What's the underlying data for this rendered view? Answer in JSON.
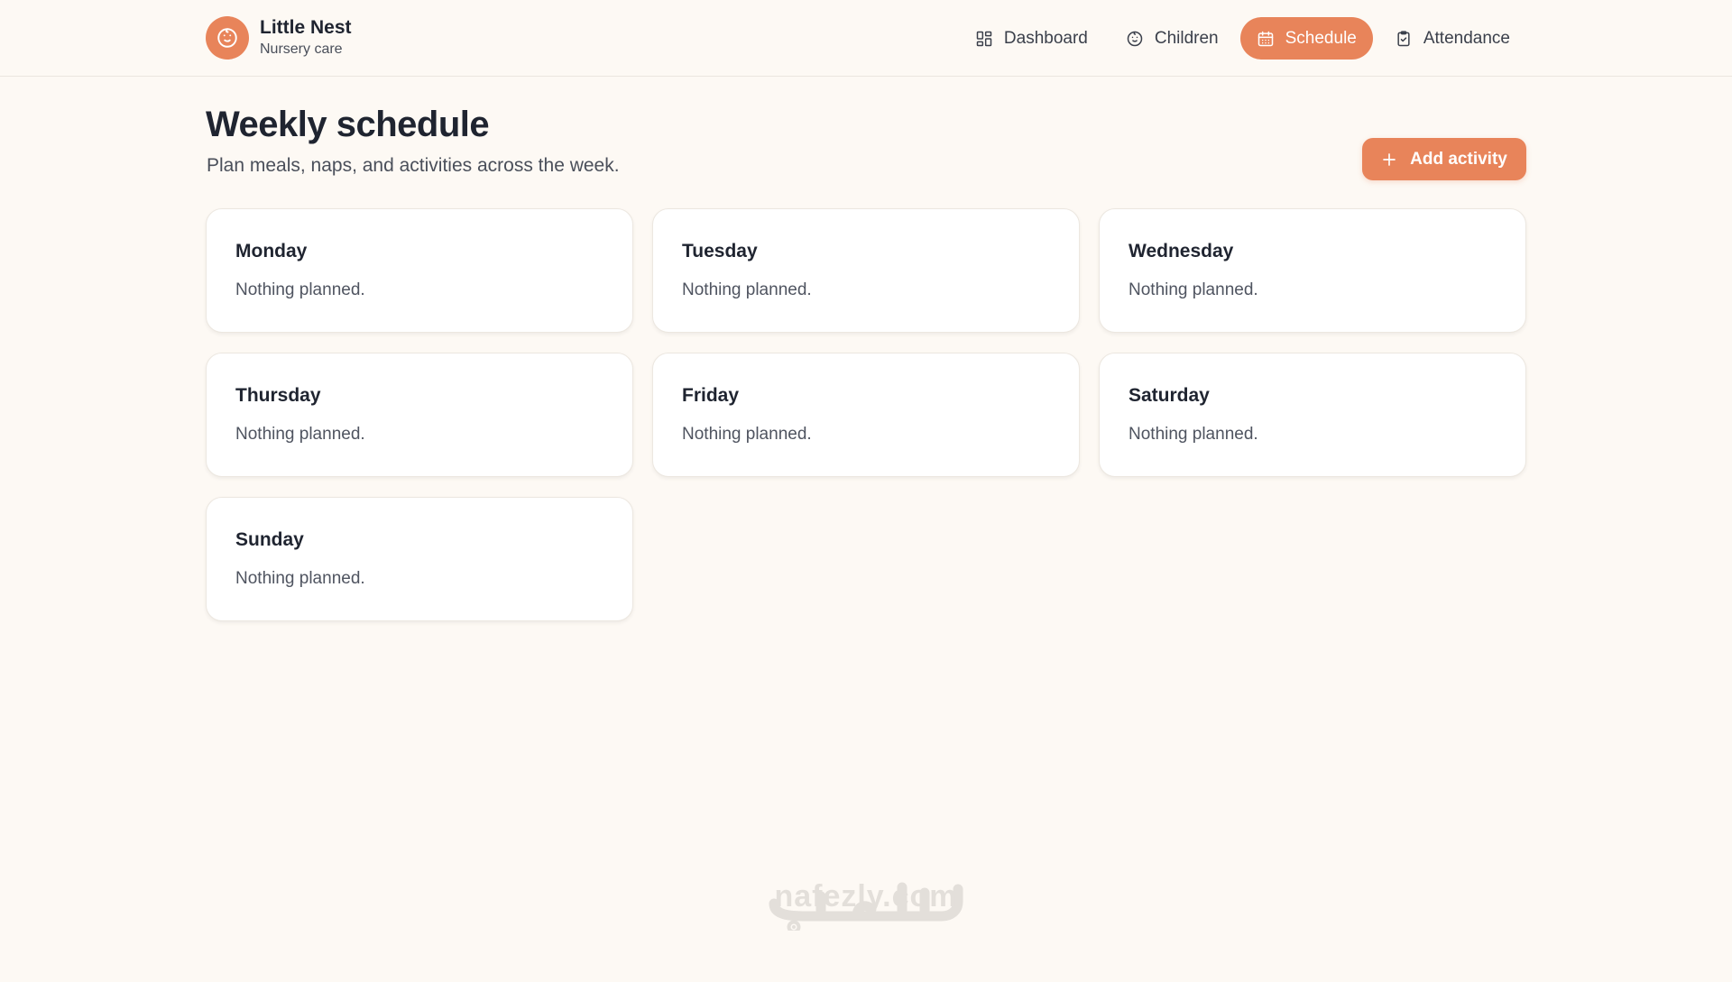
{
  "brand": {
    "name": "Little Nest",
    "subtitle": "Nursery care",
    "logo_icon": "baby-face-icon",
    "accent_color": "#e8845a"
  },
  "nav": {
    "items": [
      {
        "label": "Dashboard",
        "icon": "grid-icon",
        "active": false
      },
      {
        "label": "Children",
        "icon": "baby-face-icon",
        "active": false
      },
      {
        "label": "Schedule",
        "icon": "calendar-icon",
        "active": true
      },
      {
        "label": "Attendance",
        "icon": "clipboard-check-icon",
        "active": false
      }
    ]
  },
  "page": {
    "title": "Weekly schedule",
    "subtitle": "Plan meals, naps, and activities across the week.",
    "add_button_label": "Add activity"
  },
  "days": [
    {
      "name": "Monday",
      "status": "Nothing planned."
    },
    {
      "name": "Tuesday",
      "status": "Nothing planned."
    },
    {
      "name": "Wednesday",
      "status": "Nothing planned."
    },
    {
      "name": "Thursday",
      "status": "Nothing planned."
    },
    {
      "name": "Friday",
      "status": "Nothing planned."
    },
    {
      "name": "Saturday",
      "status": "Nothing planned."
    },
    {
      "name": "Sunday",
      "status": "Nothing planned."
    }
  ],
  "watermark": {
    "text": "nafezly.com"
  }
}
